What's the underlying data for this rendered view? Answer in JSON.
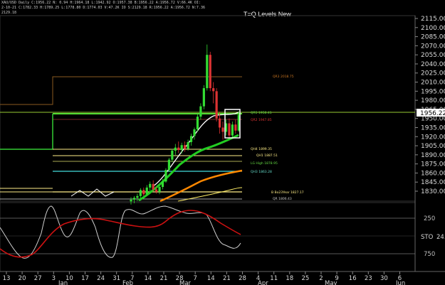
{
  "window": {
    "header_line1": "XAU/USD Daily  C:1956.22  N:  0.94  H:1964.18  L:1942.92  O:1957.38  B:1956.22  A:1956.72  V:66.4K  OI:",
    "header_line2": "2-10-21  C:1782.33  H:1789.25  L:1778.80  D:1774.03  V:47.2K  IO  S:2129.18  R:1956.22  A:1956.72  N:7.36",
    "header_line3": "2129.18",
    "title": "T=Q Levels New"
  },
  "colors": {
    "background": "#000000",
    "bull_candle": "#33dd33",
    "bear_candle": "#dd3333",
    "fast_ma": "#ffffff",
    "mid_ma": "#22cc22",
    "slow_ma": "#ff8800",
    "trend_ma": "#ffee66",
    "stoch_k": "#d0d0d0",
    "stoch_d": "#cc1111"
  },
  "price_axis": {
    "ticks": [
      "2115.00",
      "2100.00",
      "2085.00",
      "2070.00",
      "2055.00",
      "2040.00",
      "2025.00",
      "2010.00",
      "1995.00",
      "1980.00",
      "1965.00",
      "1950.00",
      "1935.00",
      "1920.00",
      "1905.00",
      "1890.00",
      "1875.00",
      "1860.00",
      "1845.00",
      "1830.00"
    ],
    "last_price": "1956.22"
  },
  "level_labels": [
    {
      "text": "QR3  2018.75",
      "color": "#cc7722"
    },
    {
      "text": "QR5  1958.41",
      "color": "#66dd44"
    },
    {
      "text": "QR2  1947.85",
      "color": "#dd3333"
    },
    {
      "text": "QH4  1899.35",
      "color": "#ffee88"
    },
    {
      "text": "QH1  1887.51",
      "color": "#ffee88"
    },
    {
      "text": "LG High  1878.95",
      "color": "#66dd44"
    },
    {
      "text": "QH3  1863.28",
      "color": "#66ddcc"
    },
    {
      "text": "B Bo23Year  1827.17",
      "color": "#ffee88"
    },
    {
      "text": "QR  1806.43",
      "color": "#cccccc"
    }
  ],
  "date_axis": {
    "days": [
      "13",
      "20",
      "27",
      "3",
      "10",
      "17",
      "24",
      "31",
      "7",
      "14",
      "21",
      "28",
      "7",
      "14",
      "21",
      "28",
      "4",
      "11",
      "18",
      "25",
      "2",
      "9",
      "16",
      "23",
      "30",
      "6"
    ],
    "months": [
      "Jan",
      "Feb",
      "Mar",
      "Apr",
      "May",
      "Jun"
    ]
  },
  "oscillator": {
    "name": "STO",
    "value": "24.",
    "levels": [
      "250",
      "750"
    ]
  },
  "chart_data": {
    "type": "candlestick",
    "title": "T=Q Levels New",
    "symbol": "XAU/USD Daily",
    "ylim": [
      1825,
      2125
    ],
    "candles": [
      {
        "date": "Feb 3",
        "o": 1813,
        "h": 1820,
        "l": 1808,
        "c": 1816
      },
      {
        "date": "Feb 4",
        "o": 1816,
        "h": 1822,
        "l": 1810,
        "c": 1819
      },
      {
        "date": "Feb 5",
        "o": 1819,
        "h": 1826,
        "l": 1814,
        "c": 1822
      },
      {
        "date": "Feb 6",
        "o": 1822,
        "h": 1835,
        "l": 1818,
        "c": 1832
      },
      {
        "date": "Feb 7",
        "o": 1832,
        "h": 1836,
        "l": 1822,
        "c": 1825
      },
      {
        "date": "Feb 10",
        "o": 1825,
        "h": 1840,
        "l": 1822,
        "c": 1836
      },
      {
        "date": "Feb 11",
        "o": 1836,
        "h": 1846,
        "l": 1830,
        "c": 1842
      },
      {
        "date": "Feb 12",
        "o": 1842,
        "h": 1848,
        "l": 1830,
        "c": 1833
      },
      {
        "date": "Feb 13",
        "o": 1833,
        "h": 1838,
        "l": 1826,
        "c": 1829
      },
      {
        "date": "Feb 14",
        "o": 1829,
        "h": 1840,
        "l": 1825,
        "c": 1837
      },
      {
        "date": "Feb 17",
        "o": 1837,
        "h": 1850,
        "l": 1833,
        "c": 1846
      },
      {
        "date": "Feb 18",
        "o": 1846,
        "h": 1868,
        "l": 1844,
        "c": 1865
      },
      {
        "date": "Feb 19",
        "o": 1865,
        "h": 1885,
        "l": 1862,
        "c": 1882
      },
      {
        "date": "Feb 20",
        "o": 1882,
        "h": 1900,
        "l": 1878,
        "c": 1897
      },
      {
        "date": "Feb 21",
        "o": 1897,
        "h": 1908,
        "l": 1890,
        "c": 1902
      },
      {
        "date": "Feb 24",
        "o": 1902,
        "h": 1912,
        "l": 1893,
        "c": 1898
      },
      {
        "date": "Feb 25",
        "o": 1898,
        "h": 1910,
        "l": 1892,
        "c": 1906
      },
      {
        "date": "Feb 26",
        "o": 1906,
        "h": 1912,
        "l": 1895,
        "c": 1900
      },
      {
        "date": "Feb 27",
        "o": 1900,
        "h": 1915,
        "l": 1897,
        "c": 1911
      },
      {
        "date": "Feb 28",
        "o": 1911,
        "h": 1925,
        "l": 1905,
        "c": 1921
      },
      {
        "date": "Mar 2",
        "o": 1921,
        "h": 1935,
        "l": 1915,
        "c": 1932
      },
      {
        "date": "Mar 3",
        "o": 1932,
        "h": 1958,
        "l": 1928,
        "c": 1953
      },
      {
        "date": "Mar 4",
        "o": 1953,
        "h": 1975,
        "l": 1948,
        "c": 1970
      },
      {
        "date": "Mar 5",
        "o": 1970,
        "h": 2005,
        "l": 1965,
        "c": 2000
      },
      {
        "date": "Mar 6",
        "o": 2000,
        "h": 2072,
        "l": 1996,
        "c": 2055
      },
      {
        "date": "Mar 9",
        "o": 2055,
        "h": 2060,
        "l": 1995,
        "c": 2000
      },
      {
        "date": "Mar 10",
        "o": 2000,
        "h": 2010,
        "l": 1975,
        "c": 1995
      },
      {
        "date": "Mar 11",
        "o": 1995,
        "h": 2000,
        "l": 1945,
        "c": 1950
      },
      {
        "date": "Mar 12",
        "o": 1950,
        "h": 1960,
        "l": 1925,
        "c": 1935
      },
      {
        "date": "Mar 13",
        "o": 1935,
        "h": 1945,
        "l": 1915,
        "c": 1928
      },
      {
        "date": "Mar 16",
        "o": 1928,
        "h": 1948,
        "l": 1922,
        "c": 1942
      },
      {
        "date": "Mar 17",
        "o": 1942,
        "h": 1950,
        "l": 1918,
        "c": 1922
      },
      {
        "date": "Mar 18",
        "o": 1922,
        "h": 1945,
        "l": 1918,
        "c": 1940
      },
      {
        "date": "Mar 19",
        "o": 1940,
        "h": 1948,
        "l": 1925,
        "c": 1930
      },
      {
        "date": "Mar 20",
        "o": 1930,
        "h": 1962,
        "l": 1928,
        "c": 1956
      }
    ],
    "levels": [
      2018.75,
      1958.41,
      1947.85,
      1899.35,
      1887.51,
      1878.95,
      1863.28,
      1827.17
    ]
  }
}
